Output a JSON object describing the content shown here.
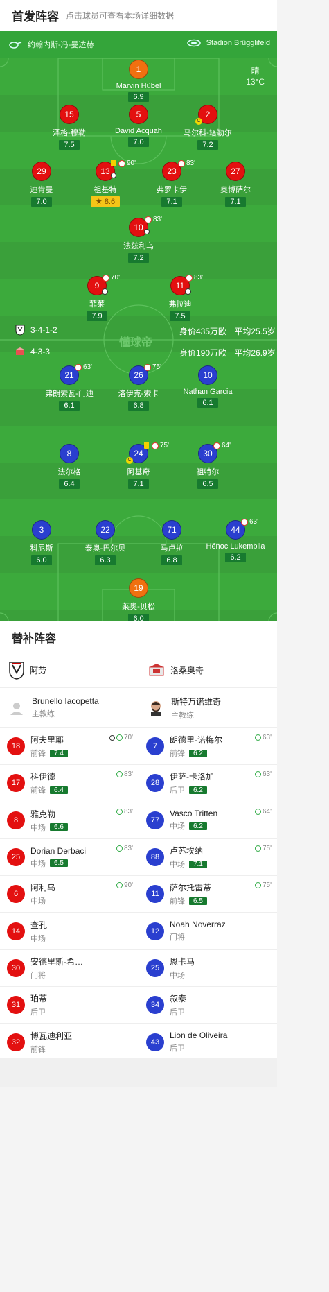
{
  "header": {
    "title": "首发阵容",
    "subtitle": "点击球员可查看本场详细数据"
  },
  "pitch": {
    "coach_home": "约翰内斯-冯-曼达赫",
    "stadium": "Stadion Brügglifeld",
    "weather": "晴",
    "temp": "13°C",
    "watermark": "懂球帝",
    "home_formation": "3-4-1-2",
    "home_value": "身价435万欧",
    "home_age": "平均25.5岁",
    "away_formation": "4-3-3",
    "away_value": "身价190万欧",
    "away_age": "平均26.9岁",
    "colors": {
      "pitch": "#3aa03a",
      "home": "#e31010",
      "away": "#2a3fcf",
      "gk": "#f07010"
    }
  },
  "home_players": [
    {
      "num": "1",
      "name": "Marvin Hübel",
      "rating": "6.9"
    },
    {
      "num": "15",
      "name": "泽格-穆勒",
      "rating": "7.5"
    },
    {
      "num": "5",
      "name": "David Acquah",
      "rating": "7.0"
    },
    {
      "num": "2",
      "name": "马尔科-塔勒尔",
      "rating": "7.2"
    },
    {
      "num": "29",
      "name": "迪肯曼",
      "rating": "7.0"
    },
    {
      "num": "13",
      "name": "祖基特",
      "rating": "8.6",
      "sub": "90'"
    },
    {
      "num": "23",
      "name": "弗罗卡伊",
      "rating": "7.1",
      "sub": "83'"
    },
    {
      "num": "27",
      "name": "奥博萨尔",
      "rating": "7.1"
    },
    {
      "num": "10",
      "name": "法兹利乌",
      "rating": "7.2",
      "sub": "83'"
    },
    {
      "num": "9",
      "name": "菲莱",
      "rating": "7.9",
      "sub": "70'"
    },
    {
      "num": "11",
      "name": "弗拉迪",
      "rating": "7.5",
      "sub": "83'"
    }
  ],
  "away_players": [
    {
      "num": "21",
      "name": "弗朗索瓦-门迪",
      "rating": "6.1",
      "sub": "63'"
    },
    {
      "num": "26",
      "name": "洛伊克-索卡",
      "rating": "6.8",
      "sub": "75'"
    },
    {
      "num": "10",
      "name": "Nathan Garcia",
      "rating": "6.1"
    },
    {
      "num": "8",
      "name": "法尔格",
      "rating": "6.4"
    },
    {
      "num": "24",
      "name": "阿基奇",
      "rating": "7.1",
      "sub": "75'"
    },
    {
      "num": "30",
      "name": "祖特尔",
      "rating": "6.5",
      "sub": "64'"
    },
    {
      "num": "3",
      "name": "科尼斯",
      "rating": "6.0"
    },
    {
      "num": "22",
      "name": "泰奥-巴尔贝",
      "rating": "6.3"
    },
    {
      "num": "71",
      "name": "马卢拉",
      "rating": "6.8"
    },
    {
      "num": "44",
      "name": "Hénoc Lukembila",
      "rating": "6.2",
      "sub": "63'"
    },
    {
      "num": "19",
      "name": "莱奥-贝松",
      "rating": "6.0"
    }
  ],
  "subs": {
    "title": "替补阵容",
    "home": {
      "team": "阿劳",
      "coach": "Brunello Iacopetta",
      "coach_role": "主教练",
      "players": [
        {
          "num": "18",
          "name": "阿夫里耶",
          "pos": "前锋",
          "rating": "7.4",
          "min": "70'"
        },
        {
          "num": "17",
          "name": "科伊德",
          "pos": "前锋",
          "rating": "6.4",
          "min": "83'"
        },
        {
          "num": "8",
          "name": "雅克勒",
          "pos": "中场",
          "rating": "6.6",
          "min": "83'"
        },
        {
          "num": "25",
          "name": "Dorian Derbaci",
          "pos": "中场",
          "rating": "6.5",
          "min": "83'"
        },
        {
          "num": "6",
          "name": "阿利乌",
          "pos": "中场",
          "rating": "",
          "min": "90'"
        },
        {
          "num": "14",
          "name": "查孔",
          "pos": "中场",
          "rating": "",
          "min": ""
        },
        {
          "num": "30",
          "name": "安德里斯-希…",
          "pos": "门将",
          "rating": "",
          "min": ""
        },
        {
          "num": "31",
          "name": "珀蒂",
          "pos": "后卫",
          "rating": "",
          "min": ""
        },
        {
          "num": "32",
          "name": "博瓦迪利亚",
          "pos": "前锋",
          "rating": "",
          "min": ""
        }
      ]
    },
    "away": {
      "team": "洛桑奥奇",
      "coach": "斯特万诺维奇",
      "coach_role": "主教练",
      "players": [
        {
          "num": "7",
          "name": "朗德里-诺梅尔",
          "pos": "前锋",
          "rating": "6.2",
          "min": "63'"
        },
        {
          "num": "28",
          "name": "伊萨-卡洛加",
          "pos": "后卫",
          "rating": "6.2",
          "min": "63'"
        },
        {
          "num": "77",
          "name": "Vasco Tritten",
          "pos": "中场",
          "rating": "6.2",
          "min": "64'"
        },
        {
          "num": "88",
          "name": "卢苏埃纳",
          "pos": "中场",
          "rating": "7.1",
          "min": "75'"
        },
        {
          "num": "11",
          "name": "萨尔托雷蒂",
          "pos": "前锋",
          "rating": "6.5",
          "min": "75'"
        },
        {
          "num": "12",
          "name": "Noah Noverraz",
          "pos": "门将",
          "rating": "",
          "min": ""
        },
        {
          "num": "25",
          "name": "恩卡马",
          "pos": "中场",
          "rating": "",
          "min": ""
        },
        {
          "num": "34",
          "name": "叙泰",
          "pos": "后卫",
          "rating": "",
          "min": ""
        },
        {
          "num": "43",
          "name": "Lion de Oliveira",
          "pos": "后卫",
          "rating": "",
          "min": ""
        }
      ]
    }
  }
}
